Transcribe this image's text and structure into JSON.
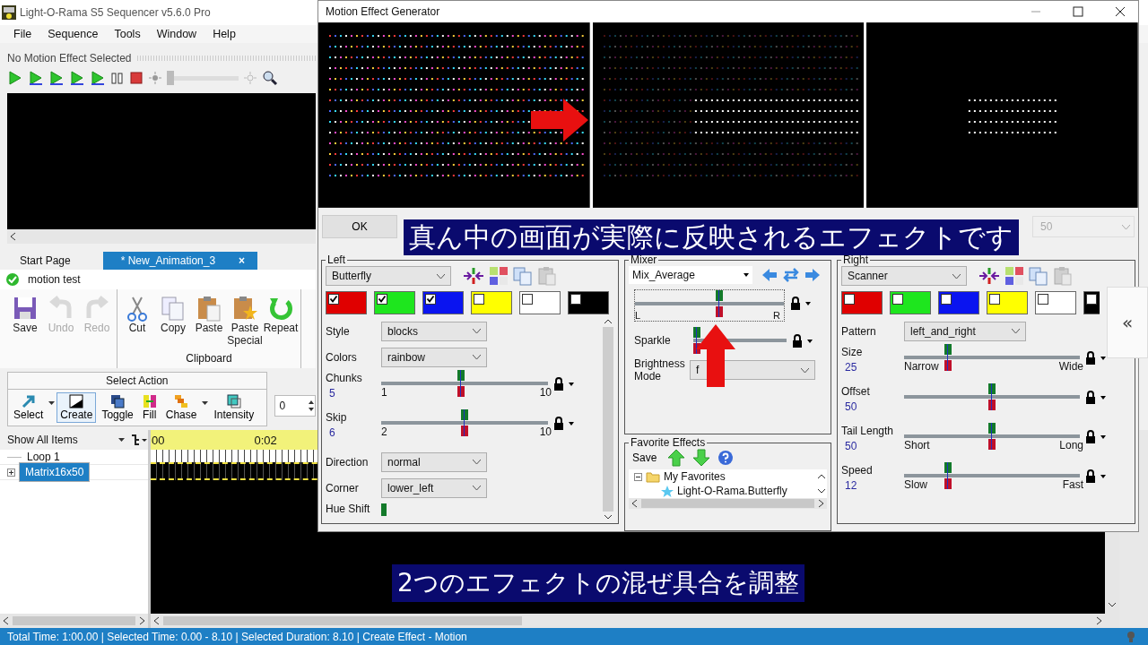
{
  "app": {
    "title": "Light-O-Rama S5 Sequencer v5.6.0 Pro",
    "menu": [
      "File",
      "Sequence",
      "Tools",
      "Window",
      "Help"
    ],
    "motion_label": "No Motion Effect Selected",
    "brightness": {
      "level": 0
    },
    "tabs": [
      {
        "label": "Start Page",
        "selected": false
      },
      {
        "label": "* New_Animation_3",
        "selected": true,
        "close": "×"
      }
    ],
    "sequence_name": "motion test",
    "ribbon": [
      {
        "label": "Save",
        "kind": "save",
        "disabled": false
      },
      {
        "label": "Undo",
        "kind": "undo",
        "disabled": true
      },
      {
        "label": "Redo",
        "kind": "redo",
        "disabled": true
      }
    ],
    "clipboard": {
      "label": "Clipboard",
      "buttons": [
        {
          "label": "Cut",
          "kind": "cut",
          "disabled": false
        },
        {
          "label": "Copy",
          "kind": "copy",
          "disabled": false
        },
        {
          "label": "Paste",
          "kind": "paste",
          "disabled": false
        },
        {
          "label": "Paste Special",
          "kind": "paste_special",
          "disabled": false
        },
        {
          "label": "Repeat",
          "kind": "repeat",
          "disabled": false
        }
      ]
    },
    "select_action": {
      "title": "Select Action",
      "tools": [
        {
          "label": "Select",
          "kind": "select",
          "selected": false,
          "dropdown": true
        },
        {
          "label": "Create",
          "kind": "create",
          "selected": true,
          "dropdown": false
        },
        {
          "label": "Toggle",
          "kind": "toggle",
          "selected": false,
          "dropdown": false
        },
        {
          "label": "Fill",
          "kind": "fill",
          "selected": false,
          "dropdown": false
        },
        {
          "label": "Chase",
          "kind": "chase",
          "selected": false,
          "dropdown": true
        },
        {
          "label": "Intensity",
          "kind": "intensity",
          "selected": false,
          "dropdown": false
        }
      ]
    },
    "spin_value": "0",
    "item_filter": "Show All Items",
    "tree": [
      {
        "label": "Loop 1",
        "selected": false
      },
      {
        "label": "Matrix16x50",
        "selected": true,
        "expanded": false
      }
    ],
    "timeline_labels": [
      "00",
      "0:02"
    ],
    "status_bar": "Total Time: 1:00.00 | Selected Time: 0.00 - 8.10 | Selected Duration: 8.10 | Create Effect - Motion"
  },
  "dialog": {
    "title": "Motion Effect Generator",
    "ok": "OK",
    "speed_field": "50",
    "left": {
      "title": "Left",
      "effect": "Butterfly",
      "swatches": [
        {
          "color": "#e00000",
          "checked": true
        },
        {
          "color": "#1ee61e",
          "checked": true
        },
        {
          "color": "#0a14f0",
          "checked": true
        },
        {
          "color": "#ffff00",
          "checked": false
        },
        {
          "color": "#ffffff",
          "checked": false
        },
        {
          "color": "#000000",
          "checked": false
        }
      ],
      "fields": [
        {
          "kind": "select",
          "label": "Style",
          "value": "blocks"
        },
        {
          "kind": "select",
          "label": "Colors",
          "value": "rainbow"
        },
        {
          "kind": "slider",
          "label": "Chunks",
          "value": "5",
          "min": "1",
          "max": "10",
          "level": 0.48
        },
        {
          "kind": "slider",
          "label": "Skip",
          "value": "6",
          "min": "2",
          "max": "10",
          "level": 0.5
        },
        {
          "kind": "select",
          "label": "Direction",
          "value": "normal"
        },
        {
          "kind": "select",
          "label": "Corner",
          "value": "lower_left"
        },
        {
          "kind": "partial",
          "label": "Hue Shift",
          "level": 0
        }
      ]
    },
    "mixer": {
      "title": "Mixer",
      "mode": "Mix_Average",
      "balance": {
        "level": 0.57,
        "min": "L",
        "max": "R"
      },
      "sparkle": {
        "label": "Sparkle",
        "level": 0
      },
      "brightness": {
        "label": "Brightness Mode",
        "value": "f"
      }
    },
    "favorites": {
      "title": "Favorite Effects",
      "save": "Save",
      "tree": [
        {
          "label": "My Favorites",
          "expanded": true,
          "children": [
            {
              "label": "Light-O-Rama.Butterfly"
            }
          ]
        }
      ]
    },
    "right": {
      "title": "Right",
      "effect": "Scanner",
      "swatches": [
        {
          "color": "#e00000",
          "checked": false
        },
        {
          "color": "#1ee61e",
          "checked": false
        },
        {
          "color": "#0a14f0",
          "checked": false
        },
        {
          "color": "#ffff00",
          "checked": false
        },
        {
          "color": "#ffffff",
          "checked": false
        },
        {
          "color": "#000000",
          "checked": false
        }
      ],
      "fields": [
        {
          "kind": "select",
          "label": "Pattern",
          "value": "left_and_right"
        },
        {
          "kind": "slider",
          "label": "Size",
          "value": "25",
          "min": "Narrow",
          "max": "Wide",
          "level": 0.24
        },
        {
          "kind": "slider",
          "label": "Offset",
          "value": "50",
          "level": 0.5
        },
        {
          "kind": "slider",
          "label": "Tail Length",
          "value": "50",
          "min": "Short",
          "max": "Long",
          "level": 0.5
        },
        {
          "kind": "slider",
          "label": "Speed",
          "value": "12",
          "min": "Slow",
          "max": "Fast",
          "level": 0.24
        }
      ]
    },
    "collapse": "«"
  },
  "captions": [
    "真ん中の画面が実際に反映されるエフェクトです",
    "2つのエフェクトの混ぜ具合を調整"
  ]
}
